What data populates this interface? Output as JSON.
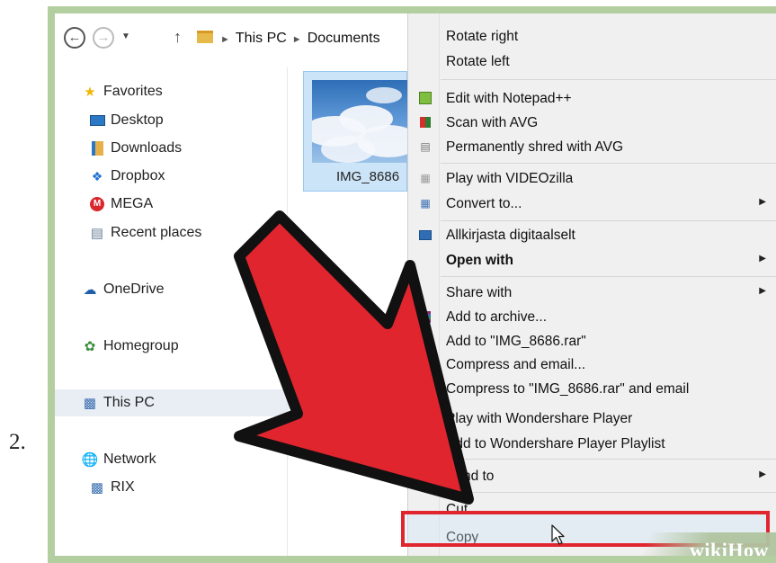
{
  "step_number": "2.",
  "address_bar": {
    "back_icon": "back-arrow-icon",
    "forward_icon": "forward-arrow-icon",
    "recent_icon": "chevron-down-icon",
    "up_icon": "up-arrow-icon",
    "crumbs": [
      "This PC",
      "Documents"
    ]
  },
  "sidebar": {
    "items": [
      {
        "label": "Favorites",
        "icon": "star-icon"
      },
      {
        "label": "Desktop",
        "icon": "desktop-icon"
      },
      {
        "label": "Downloads",
        "icon": "downloads-icon"
      },
      {
        "label": "Dropbox",
        "icon": "dropbox-icon"
      },
      {
        "label": "MEGA",
        "icon": "mega-icon"
      },
      {
        "label": "Recent places",
        "icon": "recent-places-icon"
      },
      {
        "label": "OneDrive",
        "icon": "onedrive-icon"
      },
      {
        "label": "Homegroup",
        "icon": "homegroup-icon"
      },
      {
        "label": "This PC",
        "icon": "this-pc-icon"
      },
      {
        "label": "Network",
        "icon": "network-icon"
      },
      {
        "label": "RIX",
        "icon": "computer-icon"
      }
    ]
  },
  "file": {
    "name": "IMG_8686"
  },
  "context_menu": {
    "items": [
      {
        "label": "Rotate right"
      },
      {
        "label": "Rotate left"
      },
      {
        "label": "Edit with Notepad++",
        "icon": "notepad-plus-plus-icon"
      },
      {
        "label": "Scan with AVG",
        "icon": "avg-icon"
      },
      {
        "label": "Permanently shred with AVG",
        "icon": "avg-shred-icon"
      },
      {
        "label": "Play with VIDEOzilla",
        "icon": "videozilla-icon"
      },
      {
        "label": "Convert to...",
        "icon": "convert-icon",
        "submenu": true
      },
      {
        "label": "Allkirjasta digitaalselt",
        "icon": "id-card-icon"
      },
      {
        "label": "Open with",
        "bold": true,
        "submenu": true
      },
      {
        "label": "Share with",
        "submenu": true
      },
      {
        "label": "Add to archive...",
        "icon": "winrar-icon"
      },
      {
        "label": "Add to \"IMG_8686.rar\"",
        "icon": "winrar-icon"
      },
      {
        "label": "Compress and email...",
        "icon": "winrar-icon"
      },
      {
        "label": "Compress to \"IMG_8686.rar\" and email",
        "icon": "winrar-icon"
      },
      {
        "label": "Play with Wondershare Player",
        "icon": "wondershare-icon"
      },
      {
        "label": "Add to Wondershare Player Playlist"
      },
      {
        "label": "Send to",
        "submenu": true
      },
      {
        "label": "Cut"
      },
      {
        "label": "Copy"
      }
    ]
  },
  "watermark": {
    "wiki": "wiki",
    "how": "How"
  },
  "colors": {
    "frame": "#b3cfa0",
    "arrow_fill": "#e0252f",
    "arrow_outline": "#111111",
    "highlight_border": "#e0252f",
    "menu_bg": "#f0f0f0",
    "tile_selection": "#cce4f7"
  }
}
